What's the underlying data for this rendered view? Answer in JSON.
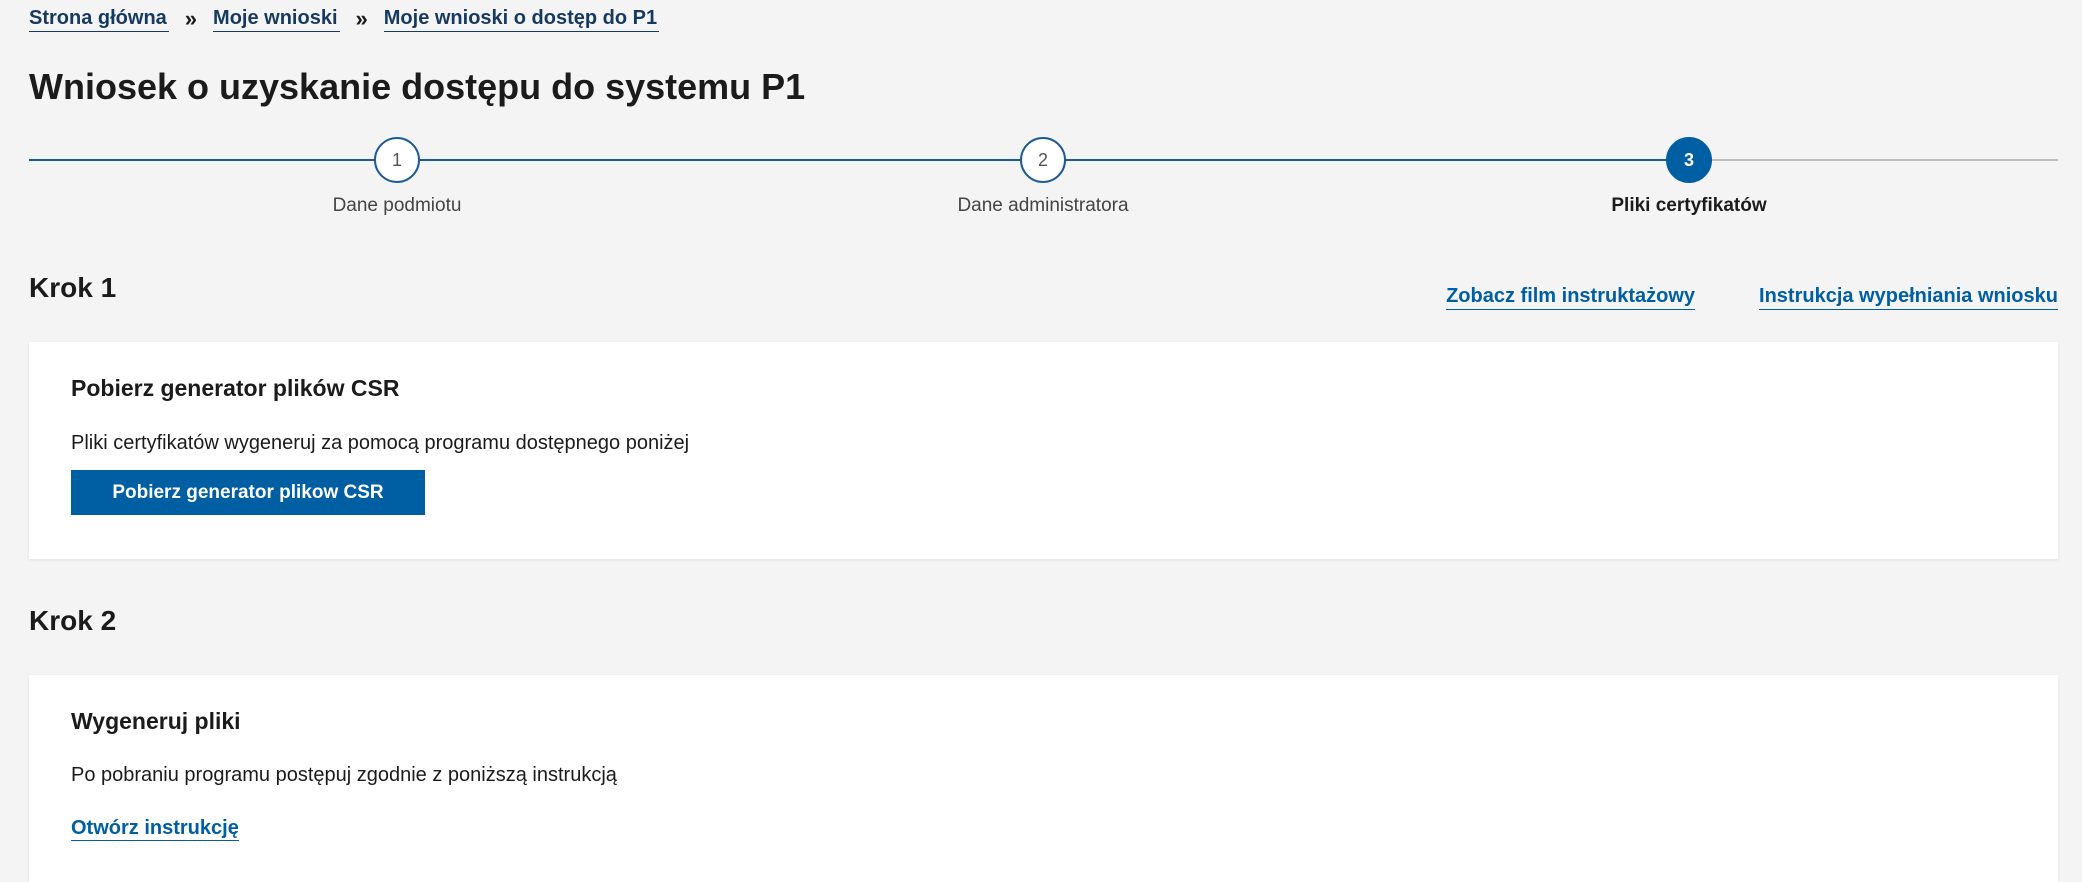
{
  "breadcrumb": {
    "items": [
      "Strona główna",
      "Moje wnioski",
      "Moje wnioski o dostęp do P1"
    ],
    "separator": "»"
  },
  "page": {
    "title": "Wniosek o uzyskanie dostępu do systemu P1"
  },
  "stepper": {
    "steps": [
      {
        "number": "1",
        "label": "Dane podmiotu",
        "state": "completed"
      },
      {
        "number": "2",
        "label": "Dane administratora",
        "state": "completed"
      },
      {
        "number": "3",
        "label": "Pliki certyfikatów",
        "state": "active"
      }
    ]
  },
  "step1": {
    "heading": "Krok 1",
    "links": {
      "video": "Zobacz film instruktażowy",
      "instructions": "Instrukcja wypełniania wniosku"
    },
    "card": {
      "title": "Pobierz generator plików CSR",
      "text": "Pliki certyfikatów wygeneruj za pomocą programu dostępnego poniżej",
      "button": "Pobierz generator plikow CSR"
    }
  },
  "step2": {
    "heading": "Krok 2",
    "card": {
      "title": "Wygeneruj pliki",
      "text": "Po pobraniu programu postępuj zgodnie z poniższą instrukcją",
      "link": "Otwórz instrukcję"
    }
  },
  "colors": {
    "primary": "#005ea2",
    "breadcrumb": "#163a5f",
    "background": "#f4f4f4",
    "step_line_done": "#1a5a96",
    "step_line_todo": "#bdbdbd"
  }
}
